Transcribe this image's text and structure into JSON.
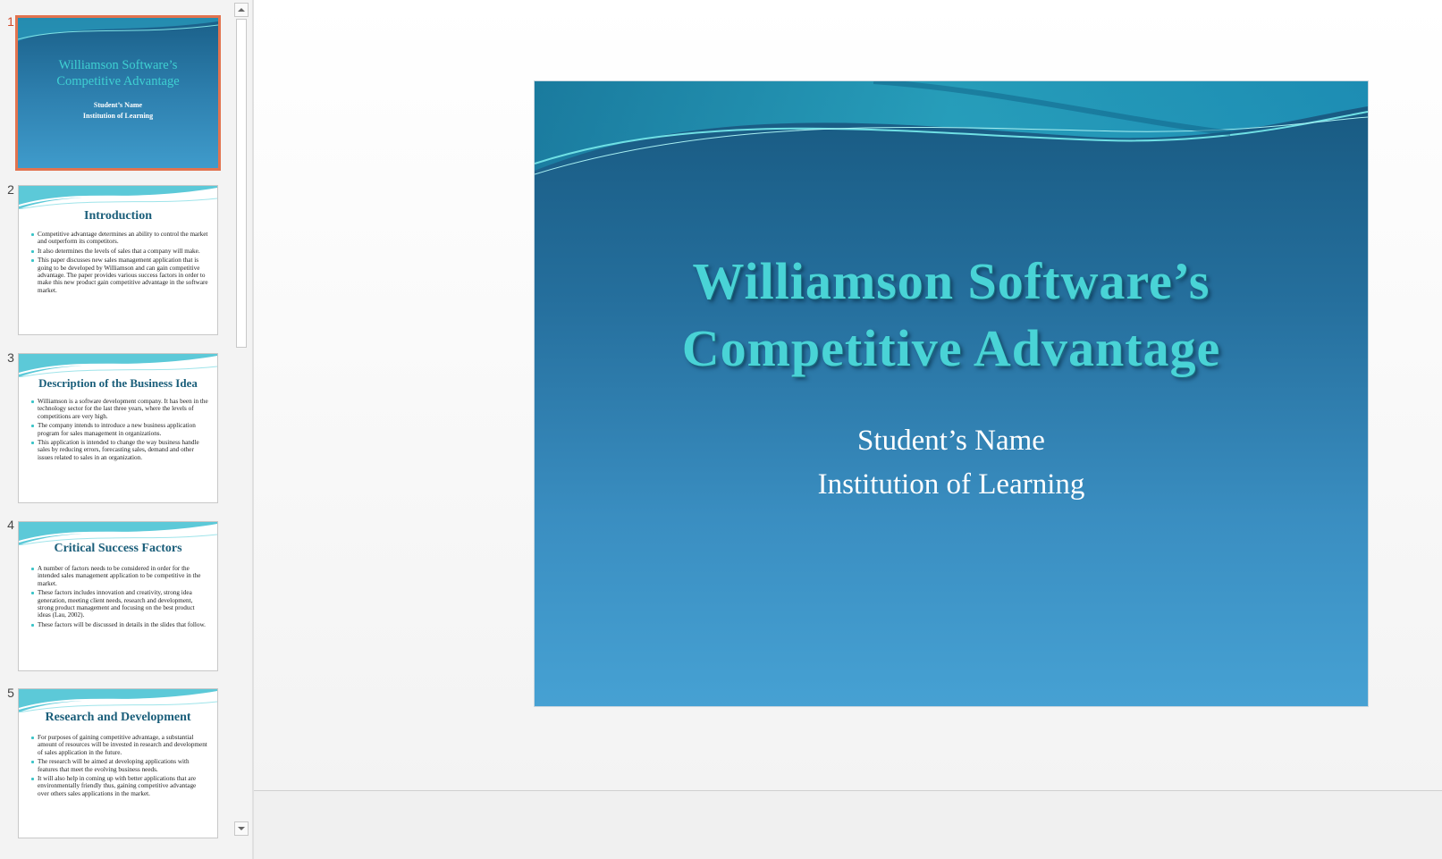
{
  "thumbnails": [
    {
      "number": "1",
      "title_line1": "Williamson Software’s",
      "title_line2": "Competitive Advantage",
      "subtitle_line1": "Student’s Name",
      "subtitle_line2": "Institution of Learning"
    },
    {
      "number": "2",
      "title": "Introduction",
      "bullets": [
        "Competitive advantage determines an ability to control the market and outperform its competitors.",
        "It also determines the levels of sales that a company will make.",
        "This paper discusses new sales management application that is going to be developed by Williamson and can gain competitive advantage. The paper provides various success factors in order to make this new product gain competitive advantage in the software market."
      ]
    },
    {
      "number": "3",
      "title": "Description of the Business Idea",
      "bullets": [
        "Williamson is a software development company. It has been in the technology sector for the last three years, where the levels of competitions are very high.",
        "The company intends to introduce a new business application program for sales management in organizations.",
        "This application is intended to change the way business handle sales by reducing errors, forecasting sales, demand and other issues related to sales in an organization."
      ]
    },
    {
      "number": "4",
      "title": "Critical Success Factors",
      "bullets": [
        "A number of factors needs to be considered in order for the intended sales management application to be competitive in the market.",
        "These factors includes innovation and creativity, strong idea generation, meeting client needs, research and development, strong product management and focusing on the best product ideas (Lau, 2002).",
        "These factors will be discussed in details in the slides that follow."
      ]
    },
    {
      "number": "5",
      "title": "Research and Development",
      "bullets": [
        "For purposes of gaining competitive advantage, a substantial amount of resources will be invested in research and development of sales application in the future.",
        "The research will be aimed at developing applications with features that meet the evolving business needs.",
        "It will also help in coming up with better applications that are environmentally friendly thus, gaining competitive advantage over others sales applications in the market."
      ]
    }
  ],
  "main_slide": {
    "title_line1": "Williamson Software’s",
    "title_line2": "Competitive Advantage",
    "subtitle_line1": "Student’s Name",
    "subtitle_line2": "Institution of Learning"
  },
  "colors": {
    "accent_selected": "#e2734f",
    "title_teal": "#49d3d6",
    "thumb_title": "#1a5e7a"
  }
}
